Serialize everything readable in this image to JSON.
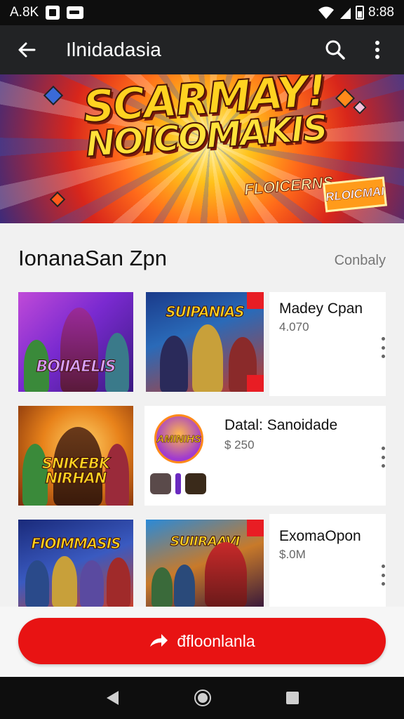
{
  "status_bar": {
    "carrier": "A.8K",
    "time": "8:88"
  },
  "app_bar": {
    "title": "Ilnidadasia",
    "back_icon": "arrow-left-icon",
    "search_icon": "search-icon",
    "more_icon": "more-vertical-icon"
  },
  "banner": {
    "line1": "SCARMAY!",
    "line2": "NOICOMAKIS",
    "subtitle": "FLOICERNS",
    "badge": "RLOICMAI"
  },
  "section": {
    "title": "IonanaSan Zpn",
    "link": "Conbaly"
  },
  "rows": [
    {
      "thumb1": {
        "label": "BOIIAELIS"
      },
      "thumb2": {
        "label": "SUIPANIAS"
      },
      "title": "Madey Cpan",
      "subtitle": "4.070"
    },
    {
      "thumb1": {
        "label": "SNIKEBK NIRHAN"
      },
      "thumb2": {
        "label": "AMINIHS"
      },
      "title": "Datal: Sanoidade",
      "subtitle": "$ 250"
    },
    {
      "thumb1": {
        "label": "FIOIMMASIS"
      },
      "thumb2": {
        "label": "SUIIRAAVI"
      },
      "title": "ExomaOpon",
      "subtitle": "$.0M"
    }
  ],
  "cta": {
    "label": "đfloonlanla",
    "icon": "share-arrow-icon"
  },
  "colors": {
    "accent": "#e81313",
    "app_bar": "#222325",
    "status_bar": "#0e0e0e"
  }
}
